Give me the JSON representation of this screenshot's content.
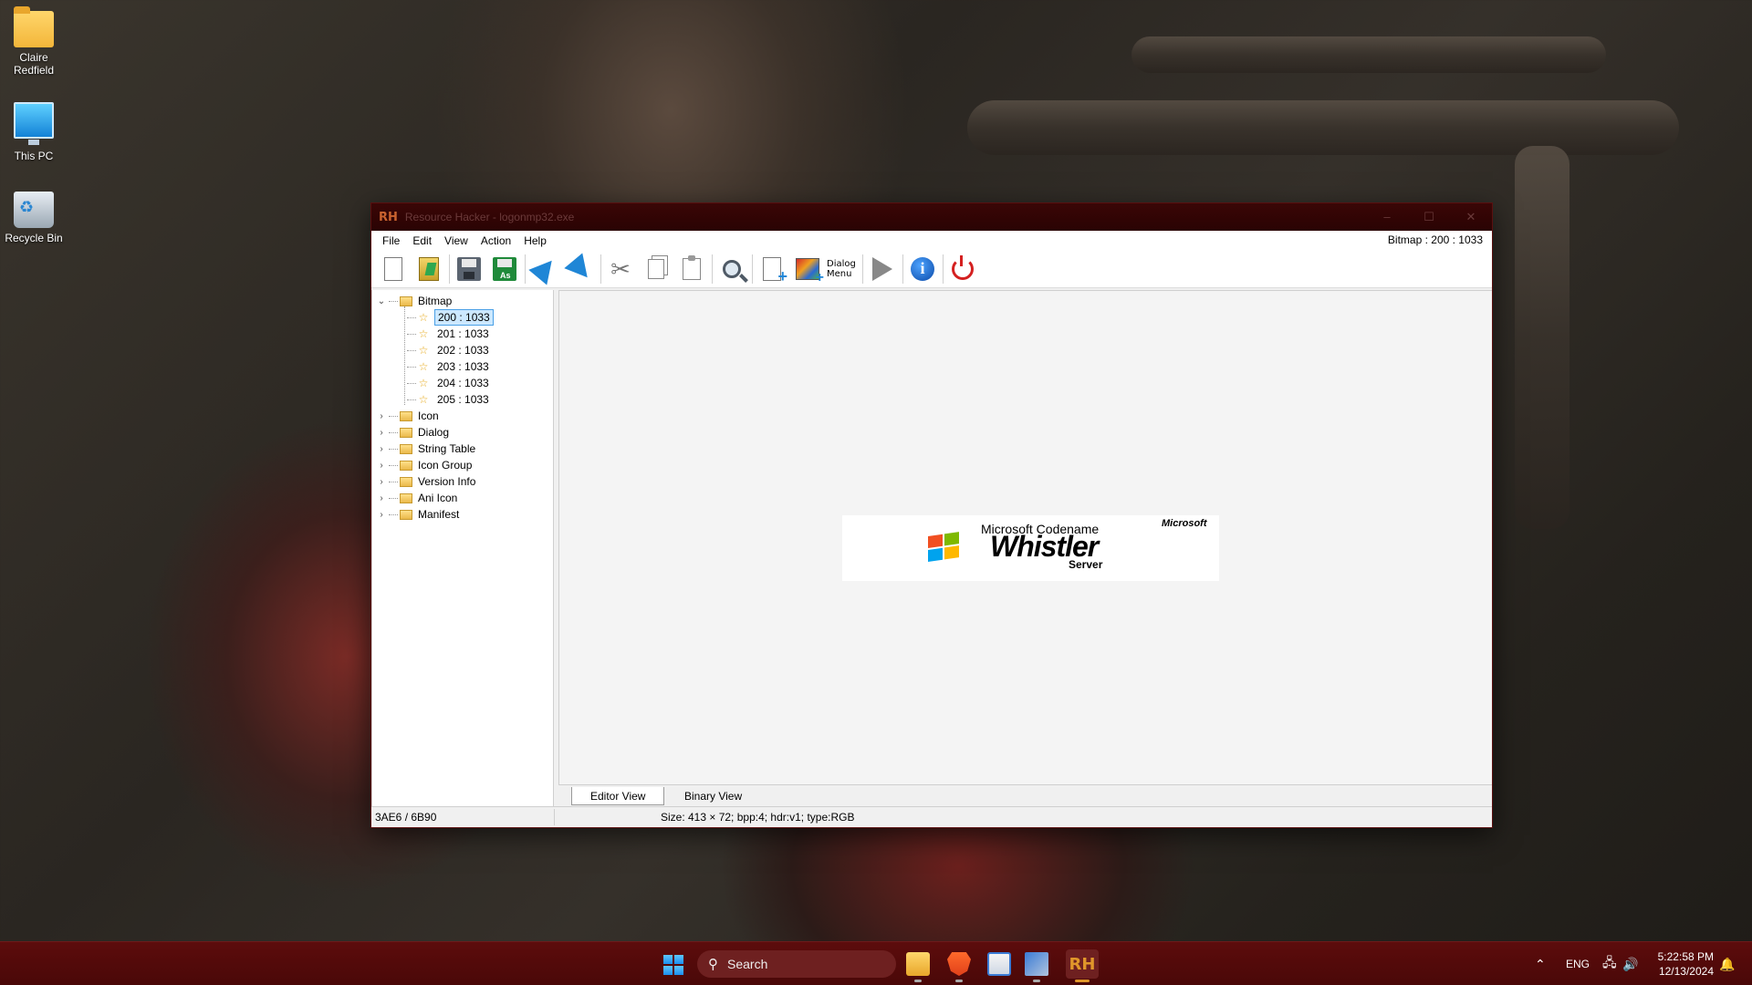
{
  "desktop": {
    "icons": [
      {
        "label": "Claire Redfield",
        "icon": "folder-icon"
      },
      {
        "label": "This PC",
        "icon": "monitor-icon"
      },
      {
        "label": "Recycle Bin",
        "icon": "recycle-bin-icon"
      }
    ]
  },
  "window": {
    "app_icon_text": "RH",
    "title": "Resource Hacker - logonmp32.exe",
    "menu": [
      "File",
      "Edit",
      "View",
      "Action",
      "Help"
    ],
    "resource_info": "Bitmap : 200 : 1033",
    "toolbar": {
      "dialog_menu_label_1": "Dialog",
      "dialog_menu_label_2": "Menu"
    },
    "tree": {
      "root": "Bitmap",
      "children": [
        "200 : 1033",
        "201 : 1033",
        "202 : 1033",
        "203 : 1033",
        "204 : 1033",
        "205 : 1033"
      ],
      "selected": "200 : 1033",
      "folders": [
        "Icon",
        "Dialog",
        "String Table",
        "Icon Group",
        "Version Info",
        "Ani Icon",
        "Manifest"
      ]
    },
    "bitmap": {
      "codename": "Microsoft Codename",
      "product": "Whistler",
      "edition": "Server",
      "brand": "Microsoft"
    },
    "tabs": {
      "editor": "Editor View",
      "binary": "Binary View"
    },
    "status": {
      "left": "3AE6 / 6B90",
      "right": "Size: 413 × 72;  bpp:4;  hdr:v1;  type:RGB"
    }
  },
  "taskbar": {
    "search_placeholder": "Search",
    "rh_label": "RH",
    "language": "ENG",
    "time": "5:22:58 PM",
    "date": "12/13/2024"
  },
  "colors": {
    "taskbar": "#4a0808",
    "titlebar": "#2a0303",
    "selection": "#cce8ff",
    "windows_flag": [
      "#f14f21",
      "#7eb900",
      "#00a3ee",
      "#feb800"
    ]
  }
}
